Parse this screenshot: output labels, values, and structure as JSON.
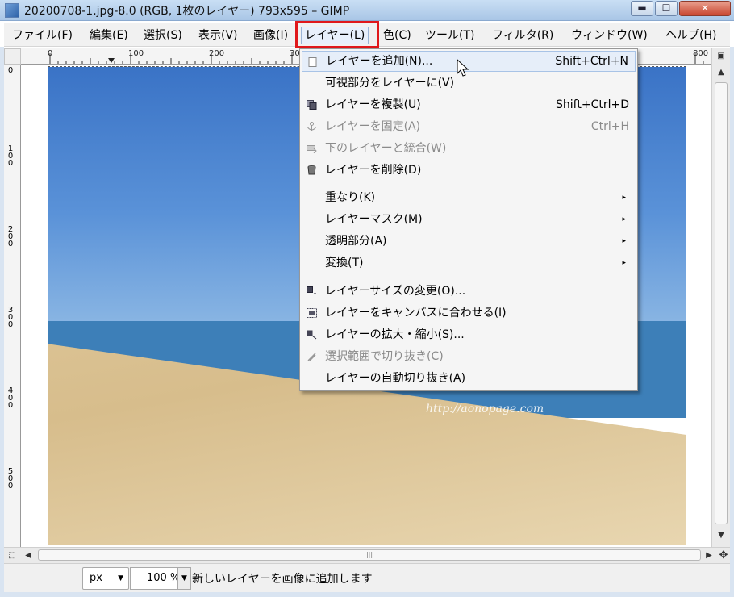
{
  "window": {
    "title": "20200708-1.jpg-8.0 (RGB, 1枚のレイヤー) 793x595 – GIMP",
    "min_glyph": "▬",
    "max_glyph": "☐",
    "close_glyph": "✕"
  },
  "menubar": {
    "items": [
      {
        "label": "ファイル(F)"
      },
      {
        "label": "編集(E)"
      },
      {
        "label": "選択(S)"
      },
      {
        "label": "表示(V)"
      },
      {
        "label": "画像(I)"
      },
      {
        "label": "レイヤー(L)"
      },
      {
        "label": "色(C)"
      },
      {
        "label": "ツール(T)"
      },
      {
        "label": "フィルタ(R)"
      },
      {
        "label": "ウィンドウ(W)"
      },
      {
        "label": "ヘルプ(H)"
      }
    ],
    "active": "レイヤー(L)"
  },
  "ruler": {
    "h_labels": [
      "0",
      "100",
      "200",
      "300",
      "800"
    ],
    "v_labels": [
      "0",
      "100",
      "200",
      "300",
      "400",
      "500"
    ]
  },
  "layer_menu": {
    "items": [
      {
        "label": "レイヤーを追加(N)...",
        "shortcut": "Shift+Ctrl+N",
        "icon": "new-layer-icon",
        "state": "hover"
      },
      {
        "label": "可視部分をレイヤーに(V)",
        "shortcut": "",
        "icon": "",
        "state": "enabled"
      },
      {
        "label": "レイヤーを複製(U)",
        "shortcut": "Shift+Ctrl+D",
        "icon": "duplicate-layer-icon",
        "state": "enabled"
      },
      {
        "label": "レイヤーを固定(A)",
        "shortcut": "Ctrl+H",
        "icon": "anchor-icon",
        "state": "disabled"
      },
      {
        "label": "下のレイヤーと統合(W)",
        "shortcut": "",
        "icon": "merge-down-icon",
        "state": "disabled"
      },
      {
        "label": "レイヤーを削除(D)",
        "shortcut": "",
        "icon": "trash-icon",
        "state": "enabled"
      },
      {
        "label": "重なり(K)",
        "submenu": true
      },
      {
        "label": "レイヤーマスク(M)",
        "submenu": true
      },
      {
        "label": "透明部分(A)",
        "submenu": true
      },
      {
        "label": "変換(T)",
        "submenu": true
      },
      {
        "label": "レイヤーサイズの変更(O)...",
        "icon": "layer-size-icon",
        "state": "enabled"
      },
      {
        "label": "レイヤーをキャンバスに合わせる(I)",
        "icon": "fit-canvas-icon",
        "state": "enabled"
      },
      {
        "label": "レイヤーの拡大・縮小(S)...",
        "icon": "scale-layer-icon",
        "state": "enabled"
      },
      {
        "label": "選択範囲で切り抜き(C)",
        "icon": "crop-icon",
        "state": "disabled"
      },
      {
        "label": "レイヤーの自動切り抜き(A)",
        "icon": "",
        "state": "enabled"
      }
    ],
    "submenu_glyph": "▸"
  },
  "canvas": {
    "watermark": "http://aonopage.com"
  },
  "statusbar": {
    "unit": "px",
    "zoom": "100 %",
    "message": "新しいレイヤーを画像に追加します",
    "combo_glyph": "▼"
  },
  "scrollbar": {
    "grip": "|||",
    "up": "▲",
    "down": "▼",
    "left": "◀",
    "right": "▶"
  }
}
